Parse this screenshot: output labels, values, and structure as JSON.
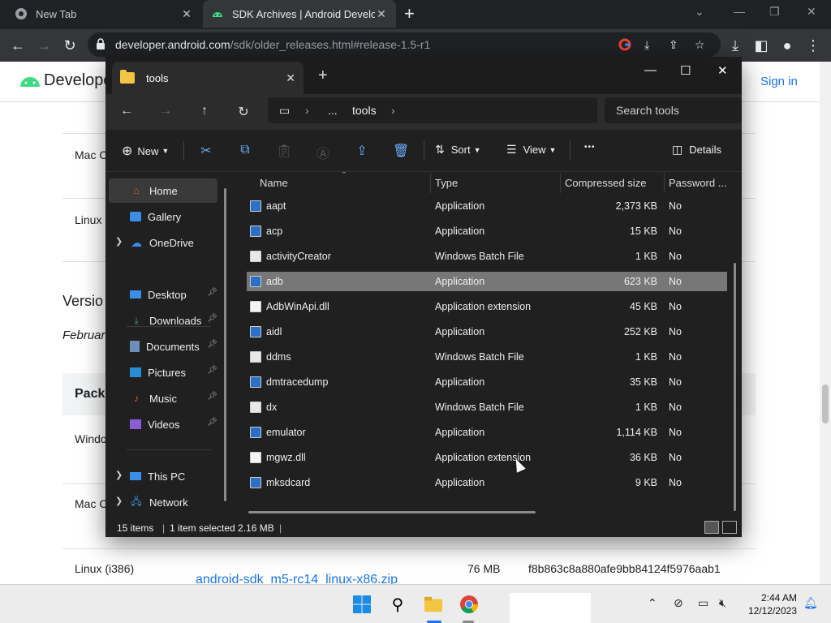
{
  "browser": {
    "tabs": [
      {
        "label": "New Tab",
        "icon": "chrome-icon"
      },
      {
        "label": "SDK Archives  |  Android Develop",
        "icon": "android-icon"
      }
    ],
    "url_host": "developer.android.com",
    "url_path": "/sdk/older_releases.html#release-1.5-r1"
  },
  "page": {
    "brand": "Develope",
    "signin": "Sign in",
    "rows_left": [
      "Mac C",
      "Linux",
      "Versio",
      "Februar",
      "Pack",
      "Windo",
      "Mac C"
    ],
    "bottom_row": {
      "platform": "Linux (i386)",
      "link": "android-sdk_m5-rc14_linux-x86.zip",
      "size": "76 MB",
      "checksum": "f8b863c8a880afe9bb84124f5976aab1"
    }
  },
  "explorer": {
    "tab_title": "tools",
    "breadcrumb": [
      "...",
      "tools"
    ],
    "search_placeholder": "Search tools",
    "commands": {
      "new": "New",
      "sort": "Sort",
      "view": "View",
      "more": "•••",
      "details": "Details"
    },
    "sidebar": [
      {
        "label": "Home",
        "icon": "home-icon"
      },
      {
        "label": "Gallery",
        "icon": "gallery-icon"
      },
      {
        "label": "OneDrive",
        "icon": "onedrive-icon"
      },
      {
        "label": "Desktop",
        "icon": "desktop-icon"
      },
      {
        "label": "Downloads",
        "icon": "downloads-icon"
      },
      {
        "label": "Documents",
        "icon": "documents-icon"
      },
      {
        "label": "Pictures",
        "icon": "pictures-icon"
      },
      {
        "label": "Music",
        "icon": "music-icon"
      },
      {
        "label": "Videos",
        "icon": "videos-icon"
      },
      {
        "label": "This PC",
        "icon": "pc-icon"
      },
      {
        "label": "Network",
        "icon": "network-icon"
      }
    ],
    "columns": [
      "Name",
      "Type",
      "Compressed size",
      "Password ..."
    ],
    "files": [
      {
        "name": "aapt",
        "type": "Application",
        "size": "2,373 KB",
        "pw": "No",
        "kind": "app"
      },
      {
        "name": "acp",
        "type": "Application",
        "size": "15 KB",
        "pw": "No",
        "kind": "app"
      },
      {
        "name": "activityCreator",
        "type": "Windows Batch File",
        "size": "1 KB",
        "pw": "No",
        "kind": "bat"
      },
      {
        "name": "adb",
        "type": "Application",
        "size": "623 KB",
        "pw": "No",
        "kind": "app",
        "selected": true
      },
      {
        "name": "AdbWinApi.dll",
        "type": "Application extension",
        "size": "45 KB",
        "pw": "No",
        "kind": "dll"
      },
      {
        "name": "aidl",
        "type": "Application",
        "size": "252 KB",
        "pw": "No",
        "kind": "app"
      },
      {
        "name": "ddms",
        "type": "Windows Batch File",
        "size": "1 KB",
        "pw": "No",
        "kind": "bat"
      },
      {
        "name": "dmtracedump",
        "type": "Application",
        "size": "35 KB",
        "pw": "No",
        "kind": "app"
      },
      {
        "name": "dx",
        "type": "Windows Batch File",
        "size": "1 KB",
        "pw": "No",
        "kind": "bat"
      },
      {
        "name": "emulator",
        "type": "Application",
        "size": "1,114 KB",
        "pw": "No",
        "kind": "app"
      },
      {
        "name": "mgwz.dll",
        "type": "Application extension",
        "size": "36 KB",
        "pw": "No",
        "kind": "dll"
      },
      {
        "name": "mksdcard",
        "type": "Application",
        "size": "9 KB",
        "pw": "No",
        "kind": "app"
      }
    ],
    "status": {
      "count": "15 items",
      "selection": "1 item selected  2.16 MB"
    }
  },
  "taskbar": {
    "time": "2:44 AM",
    "date": "12/12/2023"
  }
}
